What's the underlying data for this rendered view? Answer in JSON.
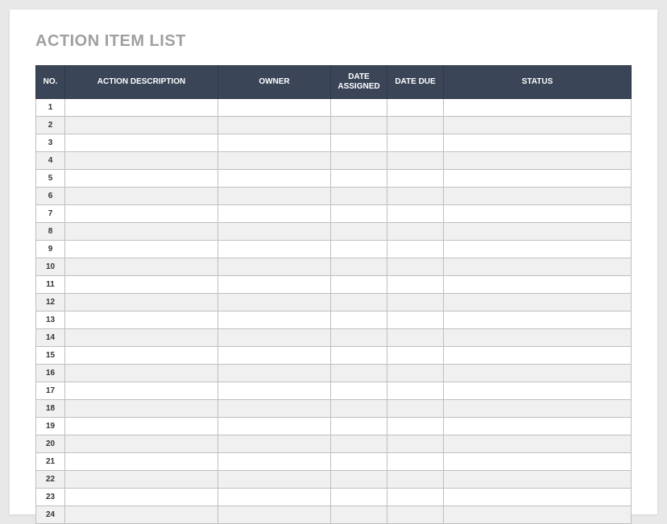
{
  "title": "ACTION ITEM LIST",
  "columns": {
    "no": "NO.",
    "description": "ACTION DESCRIPTION",
    "owner": "OWNER",
    "assigned": "DATE ASSIGNED",
    "due": "DATE DUE",
    "status": "STATUS"
  },
  "rows": [
    {
      "no": "1",
      "description": "",
      "owner": "",
      "assigned": "",
      "due": "",
      "status": ""
    },
    {
      "no": "2",
      "description": "",
      "owner": "",
      "assigned": "",
      "due": "",
      "status": ""
    },
    {
      "no": "3",
      "description": "",
      "owner": "",
      "assigned": "",
      "due": "",
      "status": ""
    },
    {
      "no": "4",
      "description": "",
      "owner": "",
      "assigned": "",
      "due": "",
      "status": ""
    },
    {
      "no": "5",
      "description": "",
      "owner": "",
      "assigned": "",
      "due": "",
      "status": ""
    },
    {
      "no": "6",
      "description": "",
      "owner": "",
      "assigned": "",
      "due": "",
      "status": ""
    },
    {
      "no": "7",
      "description": "",
      "owner": "",
      "assigned": "",
      "due": "",
      "status": ""
    },
    {
      "no": "8",
      "description": "",
      "owner": "",
      "assigned": "",
      "due": "",
      "status": ""
    },
    {
      "no": "9",
      "description": "",
      "owner": "",
      "assigned": "",
      "due": "",
      "status": ""
    },
    {
      "no": "10",
      "description": "",
      "owner": "",
      "assigned": "",
      "due": "",
      "status": ""
    },
    {
      "no": "11",
      "description": "",
      "owner": "",
      "assigned": "",
      "due": "",
      "status": ""
    },
    {
      "no": "12",
      "description": "",
      "owner": "",
      "assigned": "",
      "due": "",
      "status": ""
    },
    {
      "no": "13",
      "description": "",
      "owner": "",
      "assigned": "",
      "due": "",
      "status": ""
    },
    {
      "no": "14",
      "description": "",
      "owner": "",
      "assigned": "",
      "due": "",
      "status": ""
    },
    {
      "no": "15",
      "description": "",
      "owner": "",
      "assigned": "",
      "due": "",
      "status": ""
    },
    {
      "no": "16",
      "description": "",
      "owner": "",
      "assigned": "",
      "due": "",
      "status": ""
    },
    {
      "no": "17",
      "description": "",
      "owner": "",
      "assigned": "",
      "due": "",
      "status": ""
    },
    {
      "no": "18",
      "description": "",
      "owner": "",
      "assigned": "",
      "due": "",
      "status": ""
    },
    {
      "no": "19",
      "description": "",
      "owner": "",
      "assigned": "",
      "due": "",
      "status": ""
    },
    {
      "no": "20",
      "description": "",
      "owner": "",
      "assigned": "",
      "due": "",
      "status": ""
    },
    {
      "no": "21",
      "description": "",
      "owner": "",
      "assigned": "",
      "due": "",
      "status": ""
    },
    {
      "no": "22",
      "description": "",
      "owner": "",
      "assigned": "",
      "due": "",
      "status": ""
    },
    {
      "no": "23",
      "description": "",
      "owner": "",
      "assigned": "",
      "due": "",
      "status": ""
    },
    {
      "no": "24",
      "description": "",
      "owner": "",
      "assigned": "",
      "due": "",
      "status": ""
    }
  ]
}
